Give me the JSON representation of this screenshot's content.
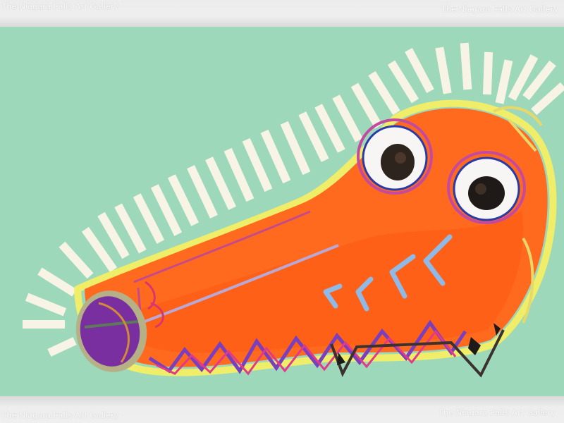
{
  "watermarks": {
    "top_left": "The Niagara Falls Art Gallery",
    "top_right": "The Niagara Falls Art Gallery",
    "bottom_left": "The Niagara Falls Art Gallery",
    "bottom_right": "The Niagara Falls Art Gallery"
  },
  "colors": {
    "background_mint": "#9fd8bb",
    "body_orange": "#ff6a1f",
    "highlight_yellow": "#f4ef63",
    "mouth_purple": "#7a2fa0",
    "stripe_white": "#f7f4e6",
    "chevron_blue": "#8fb9e6"
  }
}
